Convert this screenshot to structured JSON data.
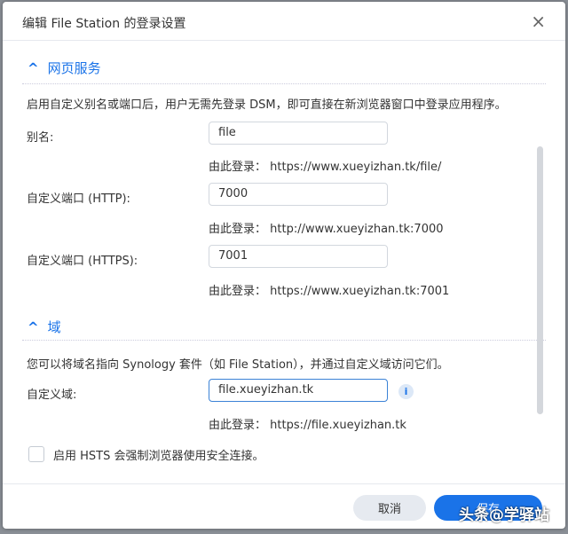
{
  "title": "编辑 File Station 的登录设置",
  "close": "×",
  "web": {
    "heading": "网页服务",
    "chev": "^",
    "desc": "启用自定义别名或端口后，用户无需先登录 DSM，即可直接在新浏览器窗口中登录应用程序。",
    "rows": [
      {
        "label": "别名:",
        "value": "file",
        "hint": "由此登录：  https://www.xueyizhan.tk/file/"
      },
      {
        "label": "自定义端口 (HTTP):",
        "value": "7000",
        "hint": "由此登录：  http://www.xueyizhan.tk:7000"
      },
      {
        "label": "自定义端口 (HTTPS):",
        "value": "7001",
        "hint": "由此登录：  https://www.xueyizhan.tk:7001"
      }
    ]
  },
  "domain": {
    "heading": "域",
    "chev": "^",
    "desc": "您可以将域名指向 Synology 套件（如 File Station），并通过自定义域访问它们。",
    "label": "自定义域:",
    "value": "file.xueyizhan.tk",
    "info": "i",
    "hint": "由此登录：  https://file.xueyizhan.tk"
  },
  "hsts": "启用 HSTS 会强制浏览器使用安全连接。",
  "buttons": {
    "cancel": "取消",
    "save": "保存"
  },
  "watermark": "头条@学驿站"
}
